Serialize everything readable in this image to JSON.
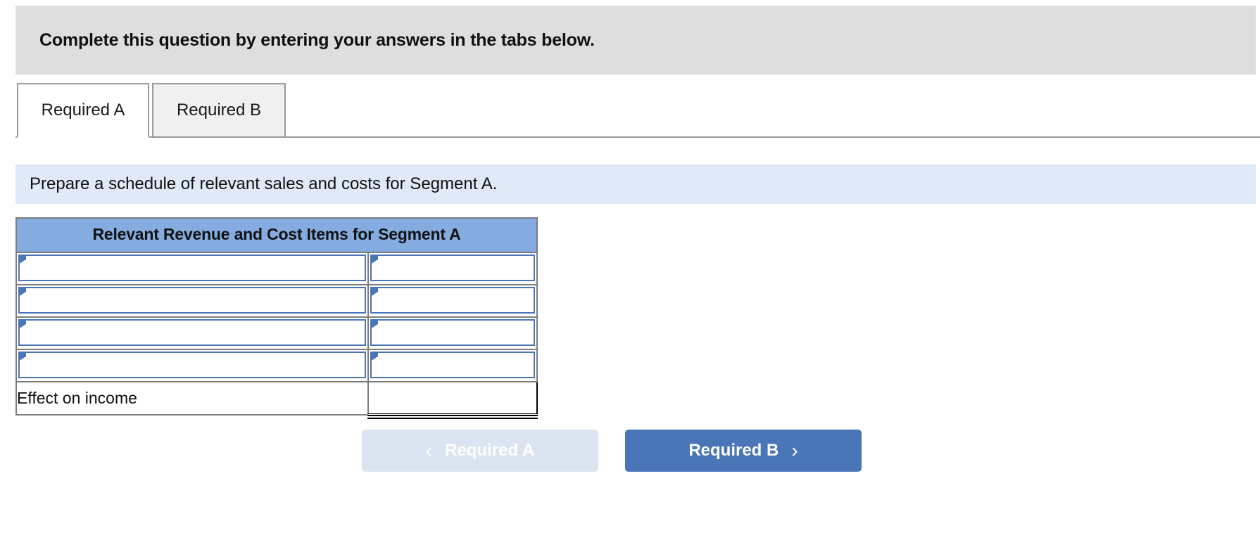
{
  "banner": {
    "text": "Complete this question by entering your answers in the tabs below."
  },
  "tabs": [
    {
      "label": "Required A",
      "state": "active"
    },
    {
      "label": "Required B",
      "state": "inactive"
    }
  ],
  "instruction": {
    "text": "Prepare a schedule of relevant sales and costs for Segment A."
  },
  "schedule": {
    "header": "Relevant Revenue and Cost Items for Segment A",
    "rows": [
      {
        "type": "dropdown",
        "label_value": "",
        "label_placeholder": "",
        "amount_value": "",
        "amount_placeholder": ""
      },
      {
        "type": "dropdown",
        "label_value": "",
        "label_placeholder": "",
        "amount_value": "",
        "amount_placeholder": ""
      },
      {
        "type": "dropdown",
        "label_value": "",
        "label_placeholder": "",
        "amount_value": "",
        "amount_placeholder": ""
      },
      {
        "type": "dropdown",
        "label_value": "",
        "label_placeholder": "",
        "amount_value": "",
        "amount_placeholder": ""
      }
    ],
    "total_row": {
      "label": "Effect on income",
      "amount_value": "",
      "amount_placeholder": ""
    }
  },
  "navigation": {
    "prev": {
      "label": "Required A",
      "icon": "chevron-left-icon",
      "glyph": "‹",
      "enabled": false
    },
    "next": {
      "label": "Required B",
      "icon": "chevron-right-icon",
      "glyph": "›",
      "enabled": true
    }
  },
  "colors": {
    "banner_bg": "#dedede",
    "instruction_bg": "#dfe9f7",
    "table_header_bg": "#84ace0",
    "accent_blue": "#4a76b8",
    "prev_button_bg": "#dbe5f1",
    "tab_inactive_bg": "#f0f0f0",
    "border_gray": "#7d7d7d"
  }
}
